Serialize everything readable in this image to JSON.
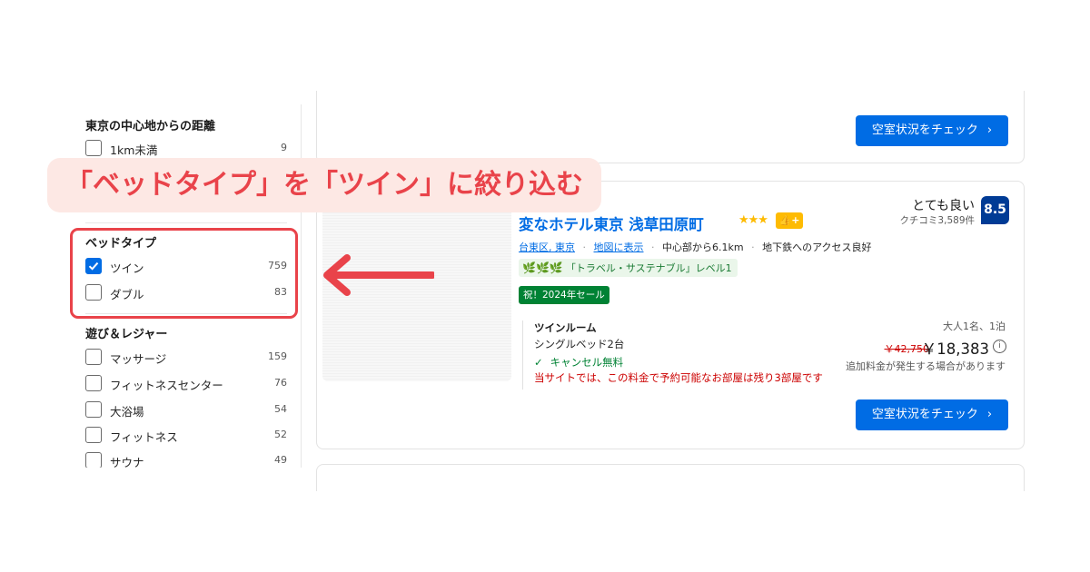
{
  "sidebar": {
    "distance": {
      "title": "東京の中心地からの距離",
      "items": [
        {
          "label": "1km未満",
          "count": "9",
          "checked": false
        }
      ]
    },
    "bed_type": {
      "title": "ベッドタイプ",
      "items": [
        {
          "label": "ツイン",
          "count": "759",
          "checked": true
        },
        {
          "label": "ダブル",
          "count": "83",
          "checked": false
        }
      ]
    },
    "leisure": {
      "title": "遊び＆レジャー",
      "items": [
        {
          "label": "マッサージ",
          "count": "159",
          "checked": false
        },
        {
          "label": "フィットネスセンター",
          "count": "76",
          "checked": false
        },
        {
          "label": "大浴場",
          "count": "54",
          "checked": false
        },
        {
          "label": "フィットネス",
          "count": "52",
          "checked": false
        },
        {
          "label": "サウナ",
          "count": "49",
          "checked": false
        }
      ]
    }
  },
  "cards": {
    "previous": {
      "button_label": "空室状況をチェック"
    },
    "hotel": {
      "name": "変なホテル東京 浅草田原町",
      "stars": "★★★",
      "badge": "👍+",
      "score_word": "とても良い",
      "reviews": "クチコミ3,589件",
      "score": "8.5",
      "location": {
        "area": "台東区, 東京",
        "map_link": "地図に表示",
        "distance": "中心部から6.1km",
        "subway": "地下鉄へのアクセス良好"
      },
      "eco_leaves": "🌿🌿🌿",
      "eco_label": "「トラベル・サステナブル」レベル1",
      "sale_label": "祝！2024年セール",
      "room": {
        "name": "ツインルーム",
        "beds": "シングルベッド2台",
        "cancel_check": "✓",
        "cancel": "キャンセル無料",
        "left": "当サイトでは、この料金で予約可能なお部屋は残り3部屋です"
      },
      "guests": "大人1名、1泊",
      "old_price": "￥42,750",
      "price": "￥18,383",
      "info": "i",
      "tax_note": "追加料金が発生する場合があります",
      "button_label": "空室状況をチェック"
    }
  },
  "chevron": "›",
  "annotation": {
    "text": "「ベッドタイプ」を「ツイン」に絞り込む",
    "color": "#e9434a",
    "banner_bg": "#fde8e4"
  },
  "colors": {
    "primary": "#006ce4",
    "score_bg": "#003b95",
    "sale_bg": "#008234",
    "star": "#febb02",
    "alert": "#cc0000"
  }
}
